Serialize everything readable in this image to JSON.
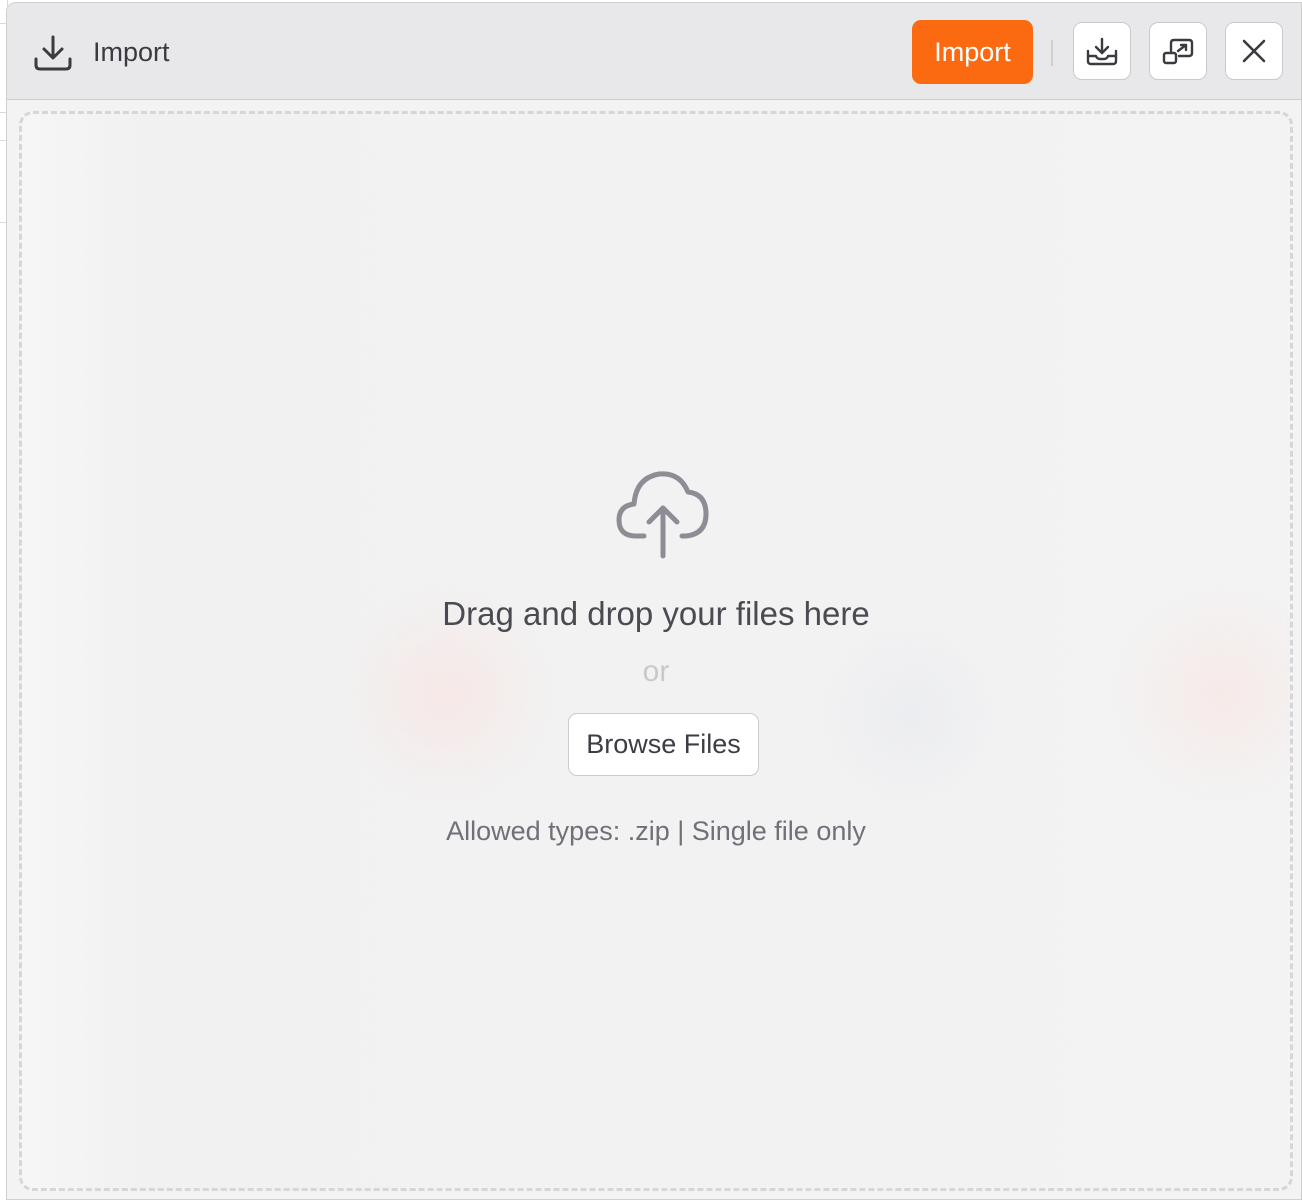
{
  "header": {
    "title": "Import",
    "title_icon": "download-tray-icon",
    "primary_button_label": "Import",
    "primary_button_color": "#FB6A10",
    "actions": [
      {
        "name": "download-button",
        "icon": "download-tray-icon"
      },
      {
        "name": "popout-button",
        "icon": "external-window-icon"
      },
      {
        "name": "close-button",
        "icon": "close-icon"
      }
    ]
  },
  "dropzone": {
    "icon": "cloud-upload-icon",
    "message": "Drag and drop your files here",
    "separator": "or",
    "browse_label": "Browse Files",
    "allowed_info": "Allowed types: .zip | Single file only"
  }
}
